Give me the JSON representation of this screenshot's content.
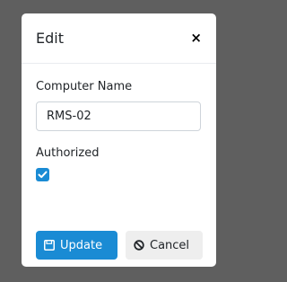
{
  "modal": {
    "title": "Edit",
    "close_glyph": "×",
    "computer_name_label": "Computer Name",
    "computer_name_value": "RMS-02",
    "authorized_label": "Authorized",
    "authorized_checked": true,
    "update_label": "Update",
    "cancel_label": "Cancel",
    "update_icon": "save-icon",
    "cancel_icon": "ban-icon",
    "accent_color": "#1a8bd4"
  }
}
